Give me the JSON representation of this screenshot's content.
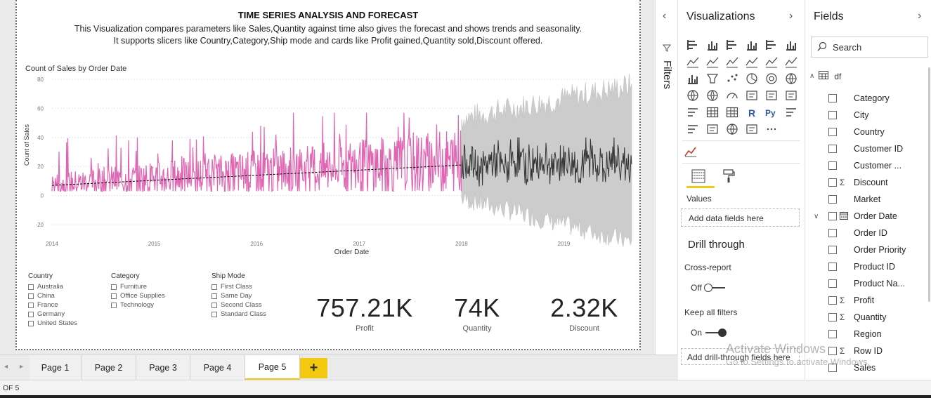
{
  "report": {
    "title": "TIME SERIES ANALYSIS AND FORECAST",
    "description_line1": "This Visualization compares parameters like Sales,Quantity against time also gives the forecast and shows trends and seasonality.",
    "description_line2": "It supports slicers like Country,Category,Ship mode and cards like Profit gained,Quantity sold,Discount offered."
  },
  "chart_data": {
    "type": "line",
    "title": "Count of Sales by Order Date",
    "xlabel": "Order Date",
    "ylabel": "Count of Sales",
    "x_ticks": [
      "2014",
      "2015",
      "2016",
      "2017",
      "2018",
      "2019"
    ],
    "y_ticks": [
      -20,
      0,
      20,
      40,
      60,
      80
    ],
    "ylim": [
      -20,
      80
    ],
    "xlim": [
      "2014-01-01",
      "2019-08-31"
    ],
    "grid": true,
    "series": [
      {
        "values_range": [
          3,
          57
        ],
        "color": "#e066b3",
        "x_range": [
          "2014-01-01",
          "2017-12-31"
        ]
      },
      {
        "values_range": [
          5,
          40
        ],
        "color": "#333333",
        "x_range": [
          "2018-01-01",
          "2019-08-31"
        ]
      }
    ],
    "trend": {
      "start": [
        "2014-01-01",
        7
      ],
      "end": [
        "2017-12-31",
        21
      ],
      "color": "#000000"
    },
    "confidence_band": {
      "lower": [
        -32,
        -2
      ],
      "upper": [
        53,
        76
      ],
      "color": "#cccccc"
    }
  },
  "slicers": [
    {
      "title": "Country",
      "items": [
        "Australia",
        "China",
        "France",
        "Germany",
        "United States"
      ]
    },
    {
      "title": "Category",
      "items": [
        "Furniture",
        "Office Supplies",
        "Technology"
      ]
    },
    {
      "title": "Ship Mode",
      "items": [
        "First Class",
        "Same Day",
        "Second Class",
        "Standard Class"
      ]
    }
  ],
  "cards": [
    {
      "value": "757.21K",
      "label": "Profit"
    },
    {
      "value": "74K",
      "label": "Quantity"
    },
    {
      "value": "2.32K",
      "label": "Discount"
    }
  ],
  "filters": {
    "label": "Filters"
  },
  "visualizations": {
    "title": "Visualizations",
    "values_label": "Values",
    "values_drop": "Add data fields here",
    "drill_title": "Drill through",
    "cross_report_label": "Cross-report",
    "cross_report_state": "Off",
    "keep_filters_label": "Keep all filters",
    "keep_filters_state": "On",
    "drill_drop": "Add drill-through fields here",
    "icons": [
      "stacked-bar-icon",
      "stacked-column-icon",
      "clustered-bar-icon",
      "clustered-column-icon",
      "100-stacked-bar-icon",
      "100-stacked-column-icon",
      "line-chart-icon",
      "area-chart-icon",
      "stacked-area-icon",
      "line-clustered-column-icon",
      "line-stacked-column-icon",
      "ribbon-chart-icon",
      "waterfall-icon",
      "funnel-icon",
      "scatter-icon",
      "pie-chart-icon",
      "donut-chart-icon",
      "treemap-icon",
      "map-icon",
      "filled-map-icon",
      "gauge-icon",
      "card-icon",
      "multi-row-card-icon",
      "kpi-icon",
      "slicer-icon",
      "table-icon",
      "matrix-icon",
      "r-visual-icon",
      "python-visual-icon",
      "key-influencers-icon",
      "decomposition-tree-icon",
      "qa-icon",
      "arcgis-icon",
      "smart-narrative-icon",
      "more-visuals-icon"
    ]
  },
  "fields": {
    "title": "Fields",
    "search_placeholder": "Search",
    "table_name": "df",
    "items": [
      {
        "label": "Category",
        "sigma": false,
        "chevron": false,
        "calendar": false
      },
      {
        "label": "City",
        "sigma": false,
        "chevron": false,
        "calendar": false
      },
      {
        "label": "Country",
        "sigma": false,
        "chevron": false,
        "calendar": false
      },
      {
        "label": "Customer ID",
        "sigma": false,
        "chevron": false,
        "calendar": false
      },
      {
        "label": "Customer ...",
        "sigma": false,
        "chevron": false,
        "calendar": false
      },
      {
        "label": "Discount",
        "sigma": true,
        "chevron": false,
        "calendar": false
      },
      {
        "label": "Market",
        "sigma": false,
        "chevron": false,
        "calendar": false
      },
      {
        "label": "Order Date",
        "sigma": false,
        "chevron": true,
        "calendar": true
      },
      {
        "label": "Order ID",
        "sigma": false,
        "chevron": false,
        "calendar": false
      },
      {
        "label": "Order Priority",
        "sigma": false,
        "chevron": false,
        "calendar": false
      },
      {
        "label": "Product ID",
        "sigma": false,
        "chevron": false,
        "calendar": false
      },
      {
        "label": "Product Na...",
        "sigma": false,
        "chevron": false,
        "calendar": false
      },
      {
        "label": "Profit",
        "sigma": true,
        "chevron": false,
        "calendar": false
      },
      {
        "label": "Quantity",
        "sigma": true,
        "chevron": false,
        "calendar": false
      },
      {
        "label": "Region",
        "sigma": false,
        "chevron": false,
        "calendar": false
      },
      {
        "label": "Row ID",
        "sigma": true,
        "chevron": false,
        "calendar": false
      },
      {
        "label": "Sales",
        "sigma": false,
        "chevron": false,
        "calendar": false
      }
    ]
  },
  "pages": {
    "tabs": [
      "Page 1",
      "Page 2",
      "Page 3",
      "Page 4",
      "Page 5"
    ],
    "active": "Page 5",
    "add_label": "+"
  },
  "status": {
    "text": "OF 5"
  },
  "watermark": {
    "line1": "Activate Windows",
    "line2": "Go to Settings to activate Windows."
  },
  "colors": {
    "accent": "#f2c811",
    "history": "#e066b3",
    "forecast": "#333333",
    "band": "#cccccc"
  }
}
